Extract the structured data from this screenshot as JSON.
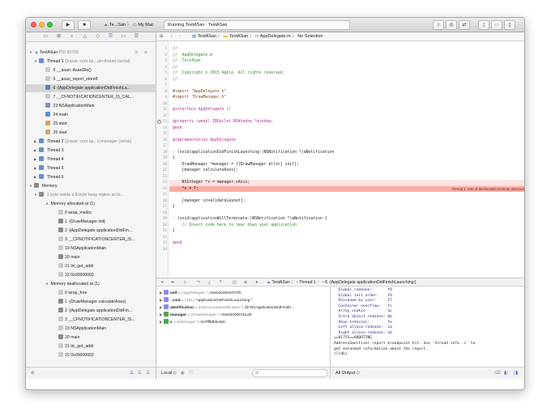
{
  "toolbar": {
    "scheme": "Te...San",
    "destination": "My Mac",
    "activity": "Running TestASan : TestASan",
    "run_icon": "play-icon",
    "stop_icon": "stop-icon"
  },
  "navigator": {
    "process": "TestASan",
    "pid": "PID 81755",
    "threads": [
      {
        "label": "Thread 1",
        "detail": "Queue: com.ap...ain-thread (serial)",
        "expanded": true
      },
      {
        "label": "Thread 2",
        "detail": "Queue: com.ap...h-manager (serial)",
        "expanded": false
      },
      {
        "label": "Thread 3",
        "detail": "",
        "expanded": false
      },
      {
        "label": "Thread 4",
        "detail": "",
        "expanded": false
      },
      {
        "label": "Thread 5",
        "detail": "",
        "expanded": false
      },
      {
        "label": "Thread 6",
        "detail": "",
        "expanded": false
      }
    ],
    "frames": [
      "0 __asan::AsanDie()",
      "5 __asan_report_store8",
      "6 -[AppDelegate applicationDidFinishLa...",
      "7 __CFNOTIFICATIONCENTER_IS_CAL...",
      "23 NSApplicationMain",
      "24 main",
      "25 start",
      "26 start"
    ],
    "memory_label": "Memory",
    "memory_detail": "1 byte inside a 8-byte heap region at 0x...",
    "allocated_label": "Memory allocated at (1)",
    "allocated": [
      "0 wrap_malloc",
      "1 -[DrawManager init]",
      "2 -[AppDelegate applicationDidFin...",
      "3 __CFNOTIFICATIONCENTER_IS...",
      "19 NSApplicationMain",
      "20 main",
      "21 tlv_get_addr",
      "22 0x00000002"
    ],
    "deallocated_label": "Memory deallocated at (1)",
    "deallocated": [
      "0 wrap_free",
      "1 -[DrawManager calculateAxes]",
      "2 -[AppDelegate applicationDidFin...",
      "3 __CFNOTIFICATIONCENTER_IS...",
      "19 NSApplicationMain",
      "20 main",
      "21 tlv_get_addr",
      "22 0x00000002"
    ]
  },
  "jumpbar": {
    "crumbs": [
      "TestASan",
      "TestASan",
      "AppDelegate.m",
      "No Selection"
    ]
  },
  "editor": {
    "line_numbers": [
      "1",
      "2",
      "3",
      "4",
      "5",
      "6",
      "7",
      "8",
      "9",
      "10",
      "11",
      "12",
      "13",
      "14",
      "15",
      "16",
      "17",
      "18",
      "19",
      "20",
      "21",
      "22",
      "23",
      "24",
      "25",
      "26",
      "27",
      "28",
      "29",
      "30",
      "31",
      "32",
      "33",
      "34"
    ],
    "lines": [
      "//",
      "//  AppDelegate.m",
      "//  TestASan",
      "//",
      "//  Copyright © 2015 Apple. All rights reserved.",
      "//",
      "",
      "#import \"AppDelegate.h\"",
      "#import \"DrawManager.h\"",
      "",
      "@interface AppDelegate ()",
      "",
      "@property (weak) IBOutlet NSWindow *window;",
      "@end",
      "",
      "@implementation AppDelegate",
      "",
      "- (void)applicationDidFinishLaunching:(NSNotification *)aNotification",
      "{",
      "    DrawManager *manager = [[DrawManager alloc] init];",
      "    [manager calculateAxes];",
      "",
      "    NSInteger *x = manager.xAxis;",
      "    *x = 7;",
      "",
      "    [manager invalidateLayout];",
      "}",
      "",
      "- (void)applicationWillTerminate:(NSNotification *)aNotification {",
      "    // Insert code here to tear down your application",
      "}",
      "",
      "@end",
      ""
    ],
    "error_message": "Thread 1: Use of deallocated memory detected"
  },
  "debugbar": {
    "crumbs": [
      "TestASan",
      "Thread 1",
      "6 -[AppDelegate applicationDidFinishLaunching:]"
    ]
  },
  "variables": [
    {
      "name": "self",
      "type": "(AppDelegate *)",
      "value": "0x60200000707f0"
    },
    {
      "name": "_cmd",
      "type": "(SEL)",
      "value": "\"applicationDidFinishLaunching:\""
    },
    {
      "name": "aNotification",
      "type": "(NSConcreteNotification *)",
      "value": "@\"NSApplicationDidFinish..."
    },
    {
      "name": "manager",
      "type": "(DrawManager *)",
      "value": "0x6020000101d0"
    },
    {
      "name": "x",
      "type": "(NSInteger *)",
      "value": "0x7fff5fbfe450"
    }
  ],
  "console": {
    "lines": [
      "  Global redzone:       f9",
      "  Global init order:    f6",
      "  Poisoned by user:     f7",
      "  Container overflow:   fc",
      "  Array cookie:         ac",
      "  Intra object redzone: bb",
      "  ASan internal:        fe",
      "  Left alloca redzone:  ca",
      "  Right alloca redzone: cb",
      "==81755==ABORTING",
      "AddressSanitizer report breakpoint hit. Use 'thread info -s' to",
      "get extended information about the report.",
      "(lldb)"
    ]
  },
  "bottom": {
    "scope": "Local ◇",
    "output": "All Output ◇"
  }
}
